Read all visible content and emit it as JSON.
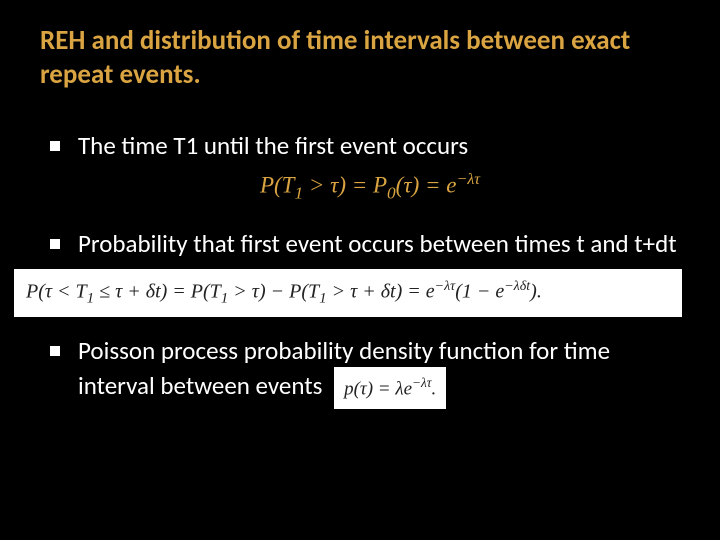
{
  "title": "REH and distribution of time intervals between exact repeat events.",
  "bullets": {
    "b1": "The time T1 until the first event occurs",
    "b2": "Probability that first event occurs between times t and t+dt",
    "b3": "Poisson process probability density function for time interval between events"
  },
  "formulas": {
    "f1_html": "P(T<sub>1</sub> &gt; &tau;) = P<sub>0</sub>(&tau;) = e<sup>&minus;&lambda;&tau;</sup>",
    "f2_html": "P(&tau; &lt; T<sub>1</sub> &le; &tau; + &delta;t) = P(T<sub>1</sub> &gt; &tau;) &minus; P(T<sub>1</sub> &gt; &tau; + &delta;t) = e<sup>&minus;&lambda;&tau;</sup>(1 &minus; e<sup>&minus;&lambda;&delta;t</sup>).",
    "f3_html": "p(&tau;) = &lambda;e<sup>&minus;&lambda;&tau;</sup>."
  }
}
